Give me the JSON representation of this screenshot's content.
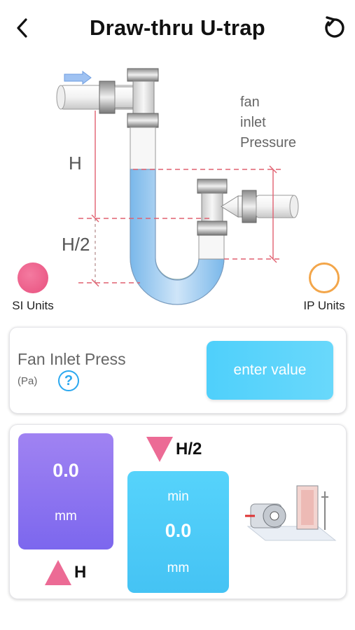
{
  "header": {
    "title": "Draw-thru U-trap",
    "back_icon": "chevron-left-icon",
    "reset_icon": "refresh-icon"
  },
  "diagram": {
    "label_h": "H",
    "label_h2": "H/2",
    "label_fan_1": "fan",
    "label_fan_2": "inlet",
    "label_fan_3": "Pressure"
  },
  "units": {
    "si_label": "SI Units",
    "ip_label": "IP Units",
    "selected": "SI Units"
  },
  "input_card": {
    "label": "Fan Inlet Press",
    "unit": "(Pa)",
    "help_glyph": "?",
    "placeholder": "enter value"
  },
  "results": {
    "h_value": "0.0",
    "h_unit": "mm",
    "h_label": "H",
    "h2_label": "H/2",
    "h2_min": "min",
    "h2_value": "0.0",
    "h2_unit": "mm"
  },
  "colors": {
    "accent_pink": "#ec6b95",
    "accent_purple": "#8a72f0",
    "accent_blue": "#4fcdfa",
    "radio_off": "#f3a64a",
    "help_blue": "#2ba8ef"
  }
}
